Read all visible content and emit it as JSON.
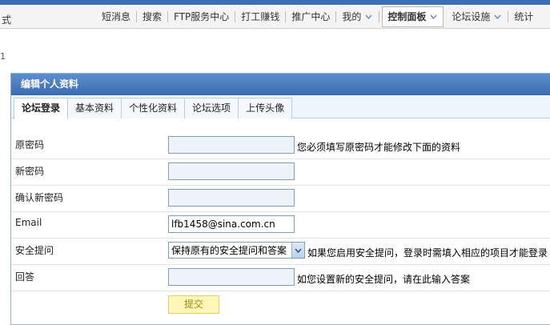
{
  "nav": {
    "left_text": "式",
    "items": [
      {
        "label": "短消息",
        "dropdown": false
      },
      {
        "label": "搜索",
        "dropdown": false
      },
      {
        "label": "FTP服务中心",
        "dropdown": false
      },
      {
        "label": "打工赚钱",
        "dropdown": false
      },
      {
        "label": "推广中心",
        "dropdown": false
      },
      {
        "label": "我的",
        "dropdown": true
      },
      {
        "label": "控制面板",
        "dropdown": true,
        "active": true
      },
      {
        "label": "论坛设施",
        "dropdown": true
      },
      {
        "label": "统计",
        "dropdown": false
      }
    ]
  },
  "breadcrumb_mark": "1",
  "panel": {
    "title": "编辑个人资料",
    "tabs": [
      "论坛登录",
      "基本资料",
      "个性化资料",
      "论坛选项",
      "上传头像"
    ],
    "active_tab": 0
  },
  "form": {
    "old_password": {
      "label": "原密码",
      "value": "",
      "hint": "您必须填写原密码才能修改下面的资料"
    },
    "new_password": {
      "label": "新密码",
      "value": ""
    },
    "confirm_password": {
      "label": "确认新密码",
      "value": ""
    },
    "email": {
      "label": "Email",
      "value": "lfb1458@sina.com.cn"
    },
    "security_question": {
      "label": "安全提问",
      "selected": "保持原有的安全提问和答案",
      "hint": "如果您启用安全提问，登录时需填入相应的项目才能登录"
    },
    "answer": {
      "label": "回答",
      "value": "",
      "hint": "如您设置新的安全提问，请在此输入答案"
    },
    "submit_label": "提交"
  },
  "colors": {
    "header_bar": "#3a6cb0",
    "tab_bg": "#eef4fb",
    "submit_bg": "#fff6b8"
  }
}
